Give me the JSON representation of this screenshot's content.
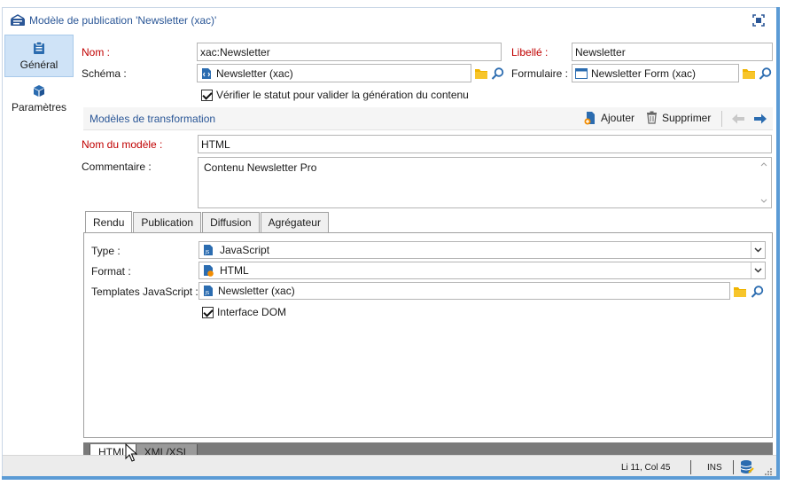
{
  "window": {
    "title": "Modèle de publication 'Newsletter (xac)'",
    "accent_color": "#5b9bd5",
    "title_color": "#2b5797",
    "required_label_color": "#c00000"
  },
  "sidebar": {
    "items": [
      {
        "label": "Général",
        "icon": "clipboard-icon",
        "active": true
      },
      {
        "label": "Paramètres",
        "icon": "cube-icon",
        "active": false
      }
    ]
  },
  "form": {
    "name_label": "Nom :",
    "name_value": "xac:Newsletter",
    "libelle_label": "Libellé :",
    "libelle_value": "Newsletter",
    "schema_label": "Schéma :",
    "schema_value": "Newsletter (xac)",
    "formulaire_label": "Formulaire :",
    "formulaire_value": "Newsletter Form (xac)",
    "check_status_label": "Vérifier le statut pour valider la génération du contenu",
    "check_status_checked": true
  },
  "transform": {
    "section_title": "Modèles de transformation",
    "add_label": "Ajouter",
    "delete_label": "Supprimer",
    "model_name_label": "Nom du modèle :",
    "model_name_value": "HTML",
    "comment_label": "Commentaire :",
    "comment_value": "Contenu Newsletter Pro"
  },
  "tabs": [
    {
      "label": "Rendu",
      "active": true
    },
    {
      "label": "Publication",
      "active": false
    },
    {
      "label": "Diffusion",
      "active": false
    },
    {
      "label": "Agrégateur",
      "active": false
    }
  ],
  "rendu": {
    "type_label": "Type :",
    "type_value": "JavaScript",
    "format_label": "Format :",
    "format_value": "HTML",
    "templates_label": "Templates JavaScript :",
    "templates_value": "Newsletter (xac)",
    "dom_label": "Interface DOM",
    "dom_checked": true
  },
  "editor_tabs": [
    {
      "label": "HTML",
      "active": true
    },
    {
      "label": "XML/XSL",
      "active": false
    }
  ],
  "statusbar": {
    "position": "Li 11, Col 45",
    "mode": "INS"
  }
}
